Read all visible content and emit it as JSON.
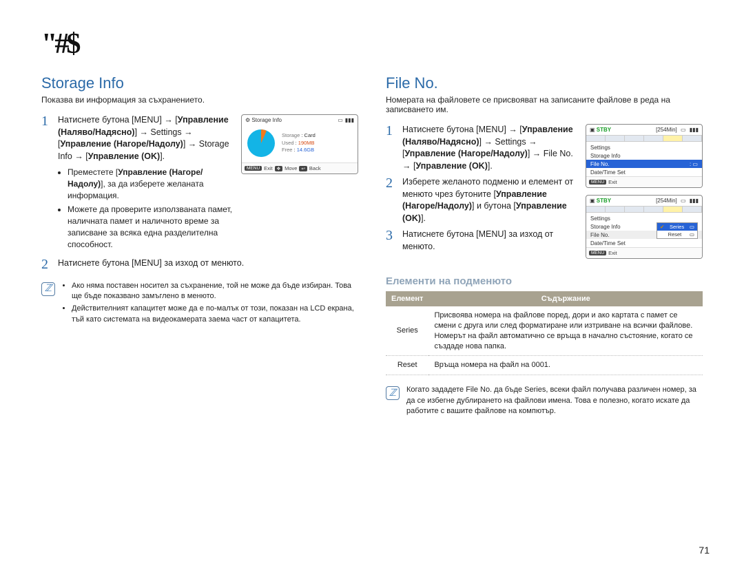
{
  "page_title": "\"#$",
  "page_number": "71",
  "storage": {
    "heading": "Storage Info",
    "subtitle": "Показва ви информация за съхранението.",
    "steps": [
      {
        "num": "1",
        "text_html": "Натиснете бутона [MENU] → [<b>Управление (Наляво/Надясно)</b>] → Settings → [<b>Управление (Нагоре/Надолу)</b>] → Storage Info → [<b>Управление (OK)</b>].",
        "bullets": [
          "Преместете [<b>Управление (Нагоре/Надолу)</b>], за да изберете желаната информация.",
          "Можете да проверите използваната памет, наличната памет и наличното време за записване за всяка една разделителна способност."
        ]
      },
      {
        "num": "2",
        "text_html": "Натиснете бутона [MENU] за изход от менюто."
      }
    ],
    "notes": [
      "Ако няма поставен носител за съхранение, той не може да бъде избиран. Това ще бъде показвано замъглено в менюто.",
      "Действителният капацитет може да е по-малък от този, показан на LCD екрана, тъй като системата на видеокамерата заема част от капацитета."
    ],
    "lcd": {
      "title": "Storage Info",
      "rows": {
        "storage_label": "Storage",
        "storage_value": "Card",
        "used_label": "Used",
        "used_value": "190MB",
        "free_label": "Free",
        "free_value": "14.6GB"
      },
      "bottom": {
        "menu": "MENU",
        "exit": "Exit",
        "move": "Move",
        "back": "Back"
      }
    }
  },
  "fileno": {
    "heading": "File No.",
    "subtitle": "Номерата на файловете се присвояват на записаните файлове в реда на записването им.",
    "steps": [
      {
        "num": "1",
        "text_html": "Натиснете бутона [MENU] → [<b>Управление (Наляво/Надясно)</b>] → Settings → [<b>Управление (Нагоре/Надолу)</b>] → File No. → [<b>Управление (OK)</b>]."
      },
      {
        "num": "2",
        "text_html": "Изберете желаното подменю и елемент от менюто чрез бутоните [<b>Управление (Нагоре/Надолу)</b>] и бутона [<b>Управление (OK)</b>]."
      },
      {
        "num": "3",
        "text_html": "Натиснете бутона [MENU] за изход от менюто."
      }
    ],
    "submenu": {
      "heading": "Елементи на подменюто",
      "th_item": "Елемент",
      "th_content": "Съдържание",
      "rows": [
        {
          "item": "Series",
          "desc": "Присвоява номера на файлове поред, дори и ако картата с памет се смени с друга или след форматиране или изтриване на всички файлове. Номерът на файл автоматично се връща в начално състояние, когато се създаде нова папка."
        },
        {
          "item": "Reset",
          "desc": "Връща номера на файл на 0001."
        }
      ]
    },
    "note_text": "Когато зададете File No. да бъде Series, всеки файл получава различен номер, за да се избегне дублирането на файлови имена. Това е полезно, когато искате да работите с вашите файлове на компютър.",
    "lcd_common": {
      "stby": "STBY",
      "time": "[254Min]",
      "menu": "MENU",
      "exit": "Exit"
    },
    "lcd1_rows": [
      "Settings",
      "Storage Info",
      "File No.",
      "Date/Time Set"
    ],
    "lcd2_rows": [
      "Settings",
      "Storage Info",
      "File No.",
      "Date/Time Set"
    ],
    "popup": {
      "opt_series": "Series",
      "opt_reset": "Reset"
    }
  }
}
